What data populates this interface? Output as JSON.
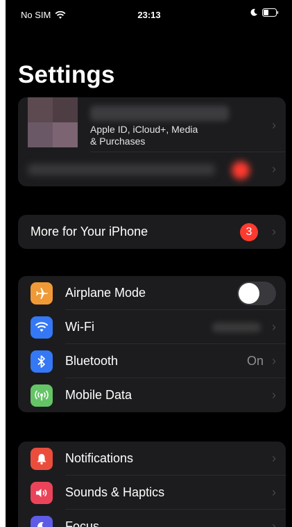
{
  "status_bar": {
    "carrier": "No SIM",
    "time": "23:13",
    "wifi_icon": "wifi-icon",
    "moon_icon": "moon-icon",
    "battery_icon": "battery-icon"
  },
  "title": "Settings",
  "profile": {
    "subtitle_line1": "Apple ID, iCloud+, Media",
    "subtitle_line2": "& Purchases"
  },
  "more_row": {
    "label": "More for Your iPhone",
    "badge": "3"
  },
  "connectivity": {
    "airplane": {
      "label": "Airplane Mode",
      "icon": "airplane-icon",
      "color": "#f09a37",
      "toggle_on": false
    },
    "wifi": {
      "label": "Wi-Fi",
      "icon": "wifi-icon",
      "color": "#3478f6"
    },
    "bluetooth": {
      "label": "Bluetooth",
      "value": "On",
      "icon": "bluetooth-icon",
      "color": "#3478f6"
    },
    "mobile": {
      "label": "Mobile Data",
      "icon": "antenna-icon",
      "color": "#65c466"
    }
  },
  "general": {
    "notifications": {
      "label": "Notifications",
      "icon": "bell-icon",
      "color": "#eb4d3d"
    },
    "sounds": {
      "label": "Sounds & Haptics",
      "icon": "speaker-icon",
      "color": "#eb445a"
    },
    "focus": {
      "label": "Focus",
      "icon": "moon-icon",
      "color": "#5e5ce6"
    }
  },
  "chevron": "›"
}
